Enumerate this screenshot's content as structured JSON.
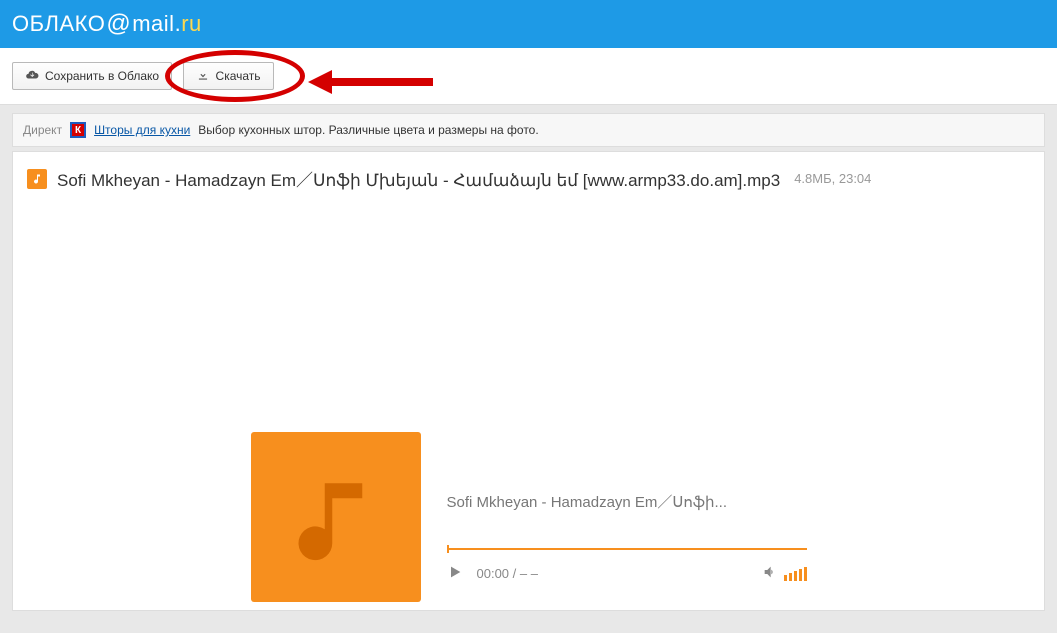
{
  "header": {
    "logo_cloud": "ОБЛАКО",
    "logo_at": "@",
    "logo_mail": "mail",
    "logo_dot": ".",
    "logo_ru": "ru"
  },
  "toolbar": {
    "save_label": "Сохранить в Облако",
    "download_label": "Скачать"
  },
  "ad": {
    "label": "Директ",
    "link": "Шторы для кухни",
    "text": "Выбор кухонных штор. Различные цвета и размеры на фото."
  },
  "file": {
    "name": "Sofi Mkheyan - Hamadzayn Em／Սոֆի Մխեյան - Համաձայն եմ [www.armp33.do.am].mp3",
    "meta": "4.8МБ, 23:04"
  },
  "player": {
    "title": "Sofi Mkheyan - Hamadzayn Em／Սոֆի...",
    "time": "00:00 / – –"
  }
}
